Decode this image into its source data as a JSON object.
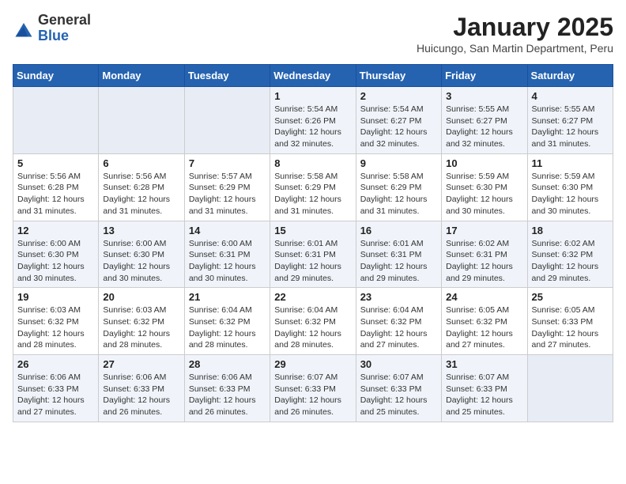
{
  "header": {
    "logo_general": "General",
    "logo_blue": "Blue",
    "month": "January 2025",
    "location": "Huicungo, San Martin Department, Peru"
  },
  "weekdays": [
    "Sunday",
    "Monday",
    "Tuesday",
    "Wednesday",
    "Thursday",
    "Friday",
    "Saturday"
  ],
  "weeks": [
    [
      {
        "day": "",
        "info": ""
      },
      {
        "day": "",
        "info": ""
      },
      {
        "day": "",
        "info": ""
      },
      {
        "day": "1",
        "info": "Sunrise: 5:54 AM\nSunset: 6:26 PM\nDaylight: 12 hours\nand 32 minutes."
      },
      {
        "day": "2",
        "info": "Sunrise: 5:54 AM\nSunset: 6:27 PM\nDaylight: 12 hours\nand 32 minutes."
      },
      {
        "day": "3",
        "info": "Sunrise: 5:55 AM\nSunset: 6:27 PM\nDaylight: 12 hours\nand 32 minutes."
      },
      {
        "day": "4",
        "info": "Sunrise: 5:55 AM\nSunset: 6:27 PM\nDaylight: 12 hours\nand 31 minutes."
      }
    ],
    [
      {
        "day": "5",
        "info": "Sunrise: 5:56 AM\nSunset: 6:28 PM\nDaylight: 12 hours\nand 31 minutes."
      },
      {
        "day": "6",
        "info": "Sunrise: 5:56 AM\nSunset: 6:28 PM\nDaylight: 12 hours\nand 31 minutes."
      },
      {
        "day": "7",
        "info": "Sunrise: 5:57 AM\nSunset: 6:29 PM\nDaylight: 12 hours\nand 31 minutes."
      },
      {
        "day": "8",
        "info": "Sunrise: 5:58 AM\nSunset: 6:29 PM\nDaylight: 12 hours\nand 31 minutes."
      },
      {
        "day": "9",
        "info": "Sunrise: 5:58 AM\nSunset: 6:29 PM\nDaylight: 12 hours\nand 31 minutes."
      },
      {
        "day": "10",
        "info": "Sunrise: 5:59 AM\nSunset: 6:30 PM\nDaylight: 12 hours\nand 30 minutes."
      },
      {
        "day": "11",
        "info": "Sunrise: 5:59 AM\nSunset: 6:30 PM\nDaylight: 12 hours\nand 30 minutes."
      }
    ],
    [
      {
        "day": "12",
        "info": "Sunrise: 6:00 AM\nSunset: 6:30 PM\nDaylight: 12 hours\nand 30 minutes."
      },
      {
        "day": "13",
        "info": "Sunrise: 6:00 AM\nSunset: 6:30 PM\nDaylight: 12 hours\nand 30 minutes."
      },
      {
        "day": "14",
        "info": "Sunrise: 6:00 AM\nSunset: 6:31 PM\nDaylight: 12 hours\nand 30 minutes."
      },
      {
        "day": "15",
        "info": "Sunrise: 6:01 AM\nSunset: 6:31 PM\nDaylight: 12 hours\nand 29 minutes."
      },
      {
        "day": "16",
        "info": "Sunrise: 6:01 AM\nSunset: 6:31 PM\nDaylight: 12 hours\nand 29 minutes."
      },
      {
        "day": "17",
        "info": "Sunrise: 6:02 AM\nSunset: 6:31 PM\nDaylight: 12 hours\nand 29 minutes."
      },
      {
        "day": "18",
        "info": "Sunrise: 6:02 AM\nSunset: 6:32 PM\nDaylight: 12 hours\nand 29 minutes."
      }
    ],
    [
      {
        "day": "19",
        "info": "Sunrise: 6:03 AM\nSunset: 6:32 PM\nDaylight: 12 hours\nand 28 minutes."
      },
      {
        "day": "20",
        "info": "Sunrise: 6:03 AM\nSunset: 6:32 PM\nDaylight: 12 hours\nand 28 minutes."
      },
      {
        "day": "21",
        "info": "Sunrise: 6:04 AM\nSunset: 6:32 PM\nDaylight: 12 hours\nand 28 minutes."
      },
      {
        "day": "22",
        "info": "Sunrise: 6:04 AM\nSunset: 6:32 PM\nDaylight: 12 hours\nand 28 minutes."
      },
      {
        "day": "23",
        "info": "Sunrise: 6:04 AM\nSunset: 6:32 PM\nDaylight: 12 hours\nand 27 minutes."
      },
      {
        "day": "24",
        "info": "Sunrise: 6:05 AM\nSunset: 6:32 PM\nDaylight: 12 hours\nand 27 minutes."
      },
      {
        "day": "25",
        "info": "Sunrise: 6:05 AM\nSunset: 6:33 PM\nDaylight: 12 hours\nand 27 minutes."
      }
    ],
    [
      {
        "day": "26",
        "info": "Sunrise: 6:06 AM\nSunset: 6:33 PM\nDaylight: 12 hours\nand 27 minutes."
      },
      {
        "day": "27",
        "info": "Sunrise: 6:06 AM\nSunset: 6:33 PM\nDaylight: 12 hours\nand 26 minutes."
      },
      {
        "day": "28",
        "info": "Sunrise: 6:06 AM\nSunset: 6:33 PM\nDaylight: 12 hours\nand 26 minutes."
      },
      {
        "day": "29",
        "info": "Sunrise: 6:07 AM\nSunset: 6:33 PM\nDaylight: 12 hours\nand 26 minutes."
      },
      {
        "day": "30",
        "info": "Sunrise: 6:07 AM\nSunset: 6:33 PM\nDaylight: 12 hours\nand 25 minutes."
      },
      {
        "day": "31",
        "info": "Sunrise: 6:07 AM\nSunset: 6:33 PM\nDaylight: 12 hours\nand 25 minutes."
      },
      {
        "day": "",
        "info": ""
      }
    ]
  ]
}
